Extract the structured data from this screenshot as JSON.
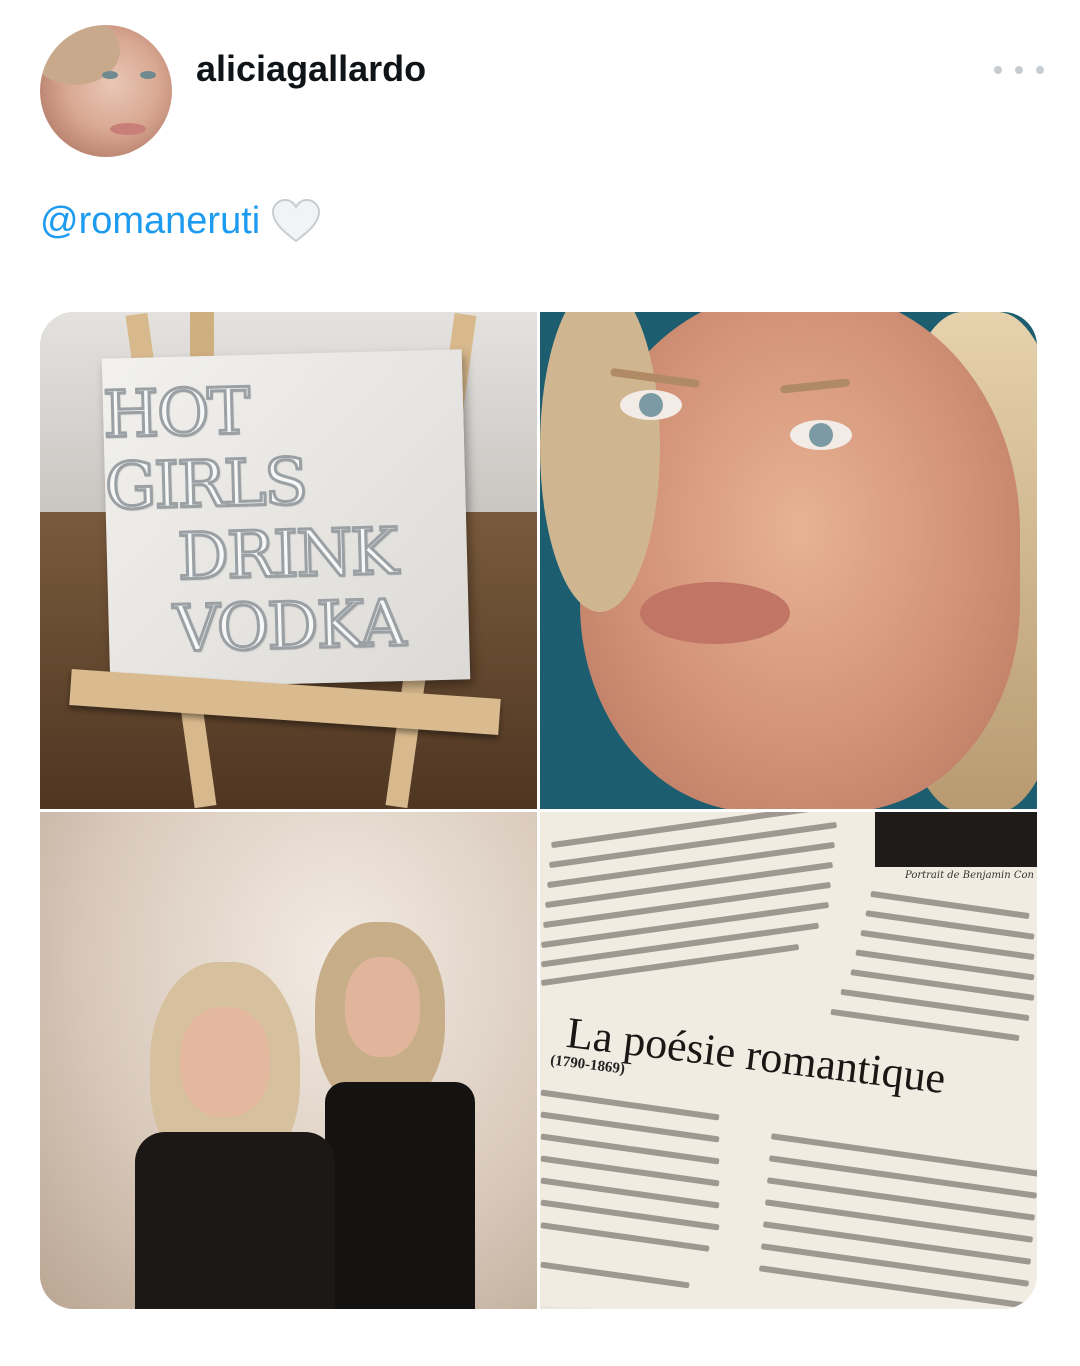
{
  "post": {
    "username": "aliciagallardo",
    "text_mention": "@romaneruti",
    "text_emoji": "white-heart-icon"
  },
  "media": {
    "canvas_text": [
      "HOT GIRLS",
      "DRINK",
      "VODKA"
    ],
    "book_caption": "Portrait de Benjamin Con",
    "book_title": "La poésie romantique",
    "book_years": "(1790-1869)"
  },
  "colors": {
    "mention": "#1d9bf0",
    "text": "#0f1419",
    "more_dots": "#c6ccd0"
  }
}
